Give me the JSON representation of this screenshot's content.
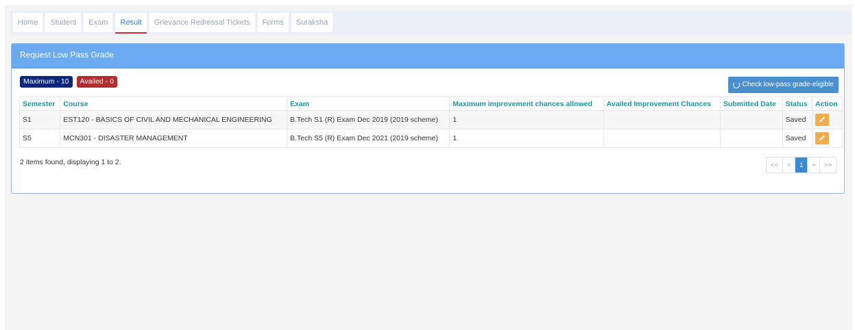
{
  "nav": {
    "tabs": [
      {
        "label": "Home"
      },
      {
        "label": "Student"
      },
      {
        "label": "Exam"
      },
      {
        "label": "Result"
      },
      {
        "label": "Grievance Redressal Tickets"
      },
      {
        "label": "Forms"
      },
      {
        "label": "Suraksha"
      }
    ],
    "active_tab": "Result"
  },
  "panel": {
    "title": "Request Low Pass Grade",
    "badges": {
      "maximum": "Maximum - 10",
      "availed": "Availed - 0"
    },
    "check_button": "Check low-pass grade-eligible"
  },
  "table": {
    "headers": [
      "Semester",
      "Course",
      "Exam",
      "Maximum improvement chances allowed",
      "Availed Improvement Chances",
      "Submitted Date",
      "Status",
      "Action"
    ],
    "rows": [
      {
        "semester": "S1",
        "course": "EST120 - BASICS OF CIVIL AND MECHANICAL ENGINEERING",
        "exam": "B.Tech S1 (R) Exam Dec 2019 (2019 scheme)",
        "max_chances": "1",
        "availed_chances": "",
        "submitted_date": "",
        "status": "Saved"
      },
      {
        "semester": "S5",
        "course": "MCN301 - DISASTER MANAGEMENT",
        "exam": "B.Tech S5 (R) Exam Dec 2021 (2019 scheme)",
        "max_chances": "1",
        "availed_chances": "",
        "submitted_date": "",
        "status": "Saved"
      }
    ]
  },
  "footer": {
    "summary": "2 items found, displaying 1 to 2.",
    "pager": [
      "<<",
      "<",
      "1",
      ">",
      ">>"
    ],
    "current_page": "1"
  },
  "colors": {
    "panel_heading": "#6aaaf0",
    "badge_max": "#0a2780",
    "badge_availed": "#b22d2d",
    "edit_button": "#f0ad4e",
    "header_text": "#1a9a9a"
  }
}
